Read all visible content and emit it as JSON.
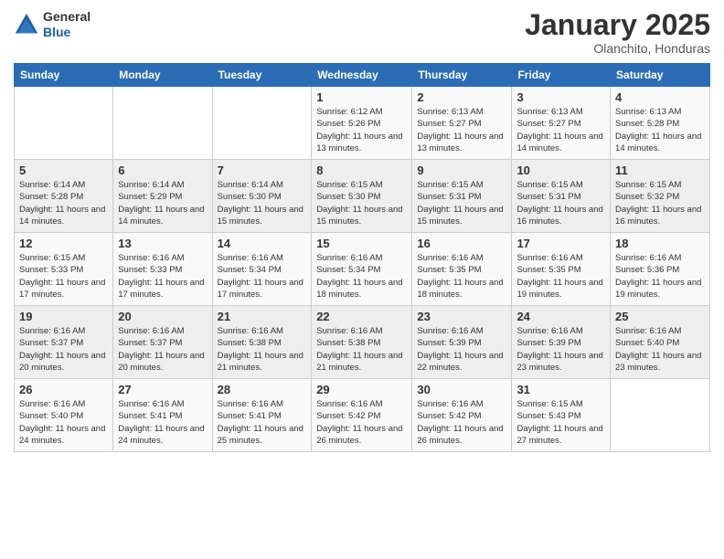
{
  "app": {
    "logo_general": "General",
    "logo_blue": "Blue"
  },
  "header": {
    "month": "January 2025",
    "location": "Olanchito, Honduras"
  },
  "weekdays": [
    "Sunday",
    "Monday",
    "Tuesday",
    "Wednesday",
    "Thursday",
    "Friday",
    "Saturday"
  ],
  "weeks": [
    [
      {
        "day": "",
        "sunrise": "",
        "sunset": "",
        "daylight": ""
      },
      {
        "day": "",
        "sunrise": "",
        "sunset": "",
        "daylight": ""
      },
      {
        "day": "",
        "sunrise": "",
        "sunset": "",
        "daylight": ""
      },
      {
        "day": "1",
        "sunrise": "Sunrise: 6:12 AM",
        "sunset": "Sunset: 5:26 PM",
        "daylight": "Daylight: 11 hours and 13 minutes."
      },
      {
        "day": "2",
        "sunrise": "Sunrise: 6:13 AM",
        "sunset": "Sunset: 5:27 PM",
        "daylight": "Daylight: 11 hours and 13 minutes."
      },
      {
        "day": "3",
        "sunrise": "Sunrise: 6:13 AM",
        "sunset": "Sunset: 5:27 PM",
        "daylight": "Daylight: 11 hours and 14 minutes."
      },
      {
        "day": "4",
        "sunrise": "Sunrise: 6:13 AM",
        "sunset": "Sunset: 5:28 PM",
        "daylight": "Daylight: 11 hours and 14 minutes."
      }
    ],
    [
      {
        "day": "5",
        "sunrise": "Sunrise: 6:14 AM",
        "sunset": "Sunset: 5:28 PM",
        "daylight": "Daylight: 11 hours and 14 minutes."
      },
      {
        "day": "6",
        "sunrise": "Sunrise: 6:14 AM",
        "sunset": "Sunset: 5:29 PM",
        "daylight": "Daylight: 11 hours and 14 minutes."
      },
      {
        "day": "7",
        "sunrise": "Sunrise: 6:14 AM",
        "sunset": "Sunset: 5:30 PM",
        "daylight": "Daylight: 11 hours and 15 minutes."
      },
      {
        "day": "8",
        "sunrise": "Sunrise: 6:15 AM",
        "sunset": "Sunset: 5:30 PM",
        "daylight": "Daylight: 11 hours and 15 minutes."
      },
      {
        "day": "9",
        "sunrise": "Sunrise: 6:15 AM",
        "sunset": "Sunset: 5:31 PM",
        "daylight": "Daylight: 11 hours and 15 minutes."
      },
      {
        "day": "10",
        "sunrise": "Sunrise: 6:15 AM",
        "sunset": "Sunset: 5:31 PM",
        "daylight": "Daylight: 11 hours and 16 minutes."
      },
      {
        "day": "11",
        "sunrise": "Sunrise: 6:15 AM",
        "sunset": "Sunset: 5:32 PM",
        "daylight": "Daylight: 11 hours and 16 minutes."
      }
    ],
    [
      {
        "day": "12",
        "sunrise": "Sunrise: 6:15 AM",
        "sunset": "Sunset: 5:33 PM",
        "daylight": "Daylight: 11 hours and 17 minutes."
      },
      {
        "day": "13",
        "sunrise": "Sunrise: 6:16 AM",
        "sunset": "Sunset: 5:33 PM",
        "daylight": "Daylight: 11 hours and 17 minutes."
      },
      {
        "day": "14",
        "sunrise": "Sunrise: 6:16 AM",
        "sunset": "Sunset: 5:34 PM",
        "daylight": "Daylight: 11 hours and 17 minutes."
      },
      {
        "day": "15",
        "sunrise": "Sunrise: 6:16 AM",
        "sunset": "Sunset: 5:34 PM",
        "daylight": "Daylight: 11 hours and 18 minutes."
      },
      {
        "day": "16",
        "sunrise": "Sunrise: 6:16 AM",
        "sunset": "Sunset: 5:35 PM",
        "daylight": "Daylight: 11 hours and 18 minutes."
      },
      {
        "day": "17",
        "sunrise": "Sunrise: 6:16 AM",
        "sunset": "Sunset: 5:35 PM",
        "daylight": "Daylight: 11 hours and 19 minutes."
      },
      {
        "day": "18",
        "sunrise": "Sunrise: 6:16 AM",
        "sunset": "Sunset: 5:36 PM",
        "daylight": "Daylight: 11 hours and 19 minutes."
      }
    ],
    [
      {
        "day": "19",
        "sunrise": "Sunrise: 6:16 AM",
        "sunset": "Sunset: 5:37 PM",
        "daylight": "Daylight: 11 hours and 20 minutes."
      },
      {
        "day": "20",
        "sunrise": "Sunrise: 6:16 AM",
        "sunset": "Sunset: 5:37 PM",
        "daylight": "Daylight: 11 hours and 20 minutes."
      },
      {
        "day": "21",
        "sunrise": "Sunrise: 6:16 AM",
        "sunset": "Sunset: 5:38 PM",
        "daylight": "Daylight: 11 hours and 21 minutes."
      },
      {
        "day": "22",
        "sunrise": "Sunrise: 6:16 AM",
        "sunset": "Sunset: 5:38 PM",
        "daylight": "Daylight: 11 hours and 21 minutes."
      },
      {
        "day": "23",
        "sunrise": "Sunrise: 6:16 AM",
        "sunset": "Sunset: 5:39 PM",
        "daylight": "Daylight: 11 hours and 22 minutes."
      },
      {
        "day": "24",
        "sunrise": "Sunrise: 6:16 AM",
        "sunset": "Sunset: 5:39 PM",
        "daylight": "Daylight: 11 hours and 23 minutes."
      },
      {
        "day": "25",
        "sunrise": "Sunrise: 6:16 AM",
        "sunset": "Sunset: 5:40 PM",
        "daylight": "Daylight: 11 hours and 23 minutes."
      }
    ],
    [
      {
        "day": "26",
        "sunrise": "Sunrise: 6:16 AM",
        "sunset": "Sunset: 5:40 PM",
        "daylight": "Daylight: 11 hours and 24 minutes."
      },
      {
        "day": "27",
        "sunrise": "Sunrise: 6:16 AM",
        "sunset": "Sunset: 5:41 PM",
        "daylight": "Daylight: 11 hours and 24 minutes."
      },
      {
        "day": "28",
        "sunrise": "Sunrise: 6:16 AM",
        "sunset": "Sunset: 5:41 PM",
        "daylight": "Daylight: 11 hours and 25 minutes."
      },
      {
        "day": "29",
        "sunrise": "Sunrise: 6:16 AM",
        "sunset": "Sunset: 5:42 PM",
        "daylight": "Daylight: 11 hours and 26 minutes."
      },
      {
        "day": "30",
        "sunrise": "Sunrise: 6:16 AM",
        "sunset": "Sunset: 5:42 PM",
        "daylight": "Daylight: 11 hours and 26 minutes."
      },
      {
        "day": "31",
        "sunrise": "Sunrise: 6:15 AM",
        "sunset": "Sunset: 5:43 PM",
        "daylight": "Daylight: 11 hours and 27 minutes."
      },
      {
        "day": "",
        "sunrise": "",
        "sunset": "",
        "daylight": ""
      }
    ]
  ]
}
